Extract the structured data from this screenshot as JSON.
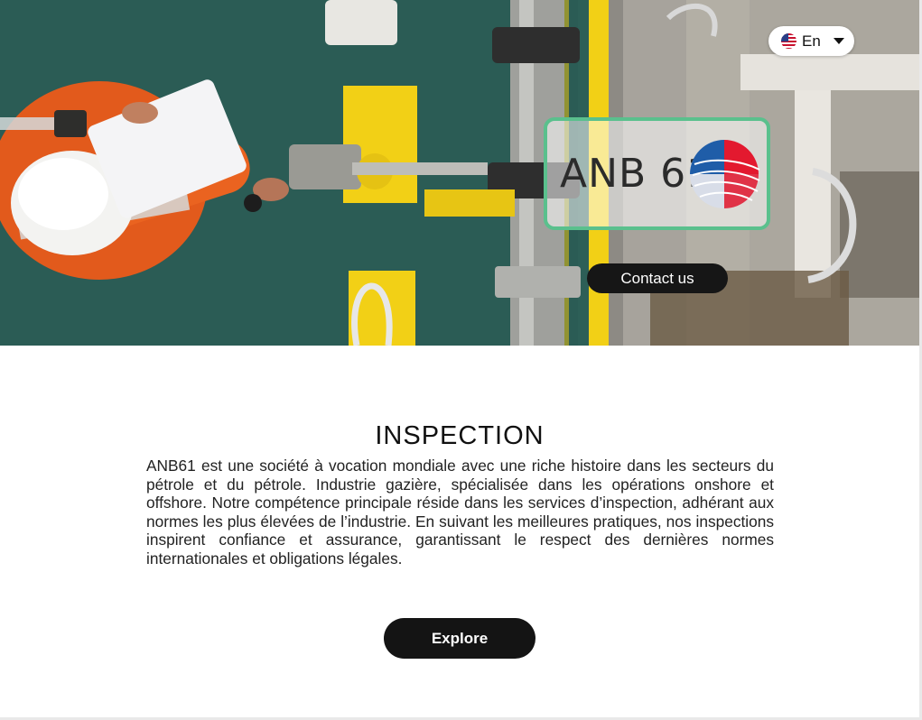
{
  "language": {
    "label": "En",
    "flag_icon": "us-flag-icon"
  },
  "hero": {
    "logo_text": "ANB 61",
    "contact_label": "Contact us"
  },
  "section": {
    "title": "INSPECTION",
    "description": "ANB61 est une société à vocation mondiale avec une riche histoire dans les secteurs du pétrole et du pétrole. Industrie gazière, spécialisée dans les opérations onshore et offshore. Notre compétence principale réside dans les services d’inspection, adhérant aux normes les plus élevées de l’industrie. En suivant les meilleures pratiques, nos inspections inspirent confiance et assurance, garantissant le respect des dernières normes internationales et obligations légales.",
    "explore_label": "Explore"
  },
  "colors": {
    "button_bg": "#141414",
    "logo_border": "#5ac08d",
    "floor": "#2c5e56",
    "safety_yellow": "#f2d016"
  }
}
